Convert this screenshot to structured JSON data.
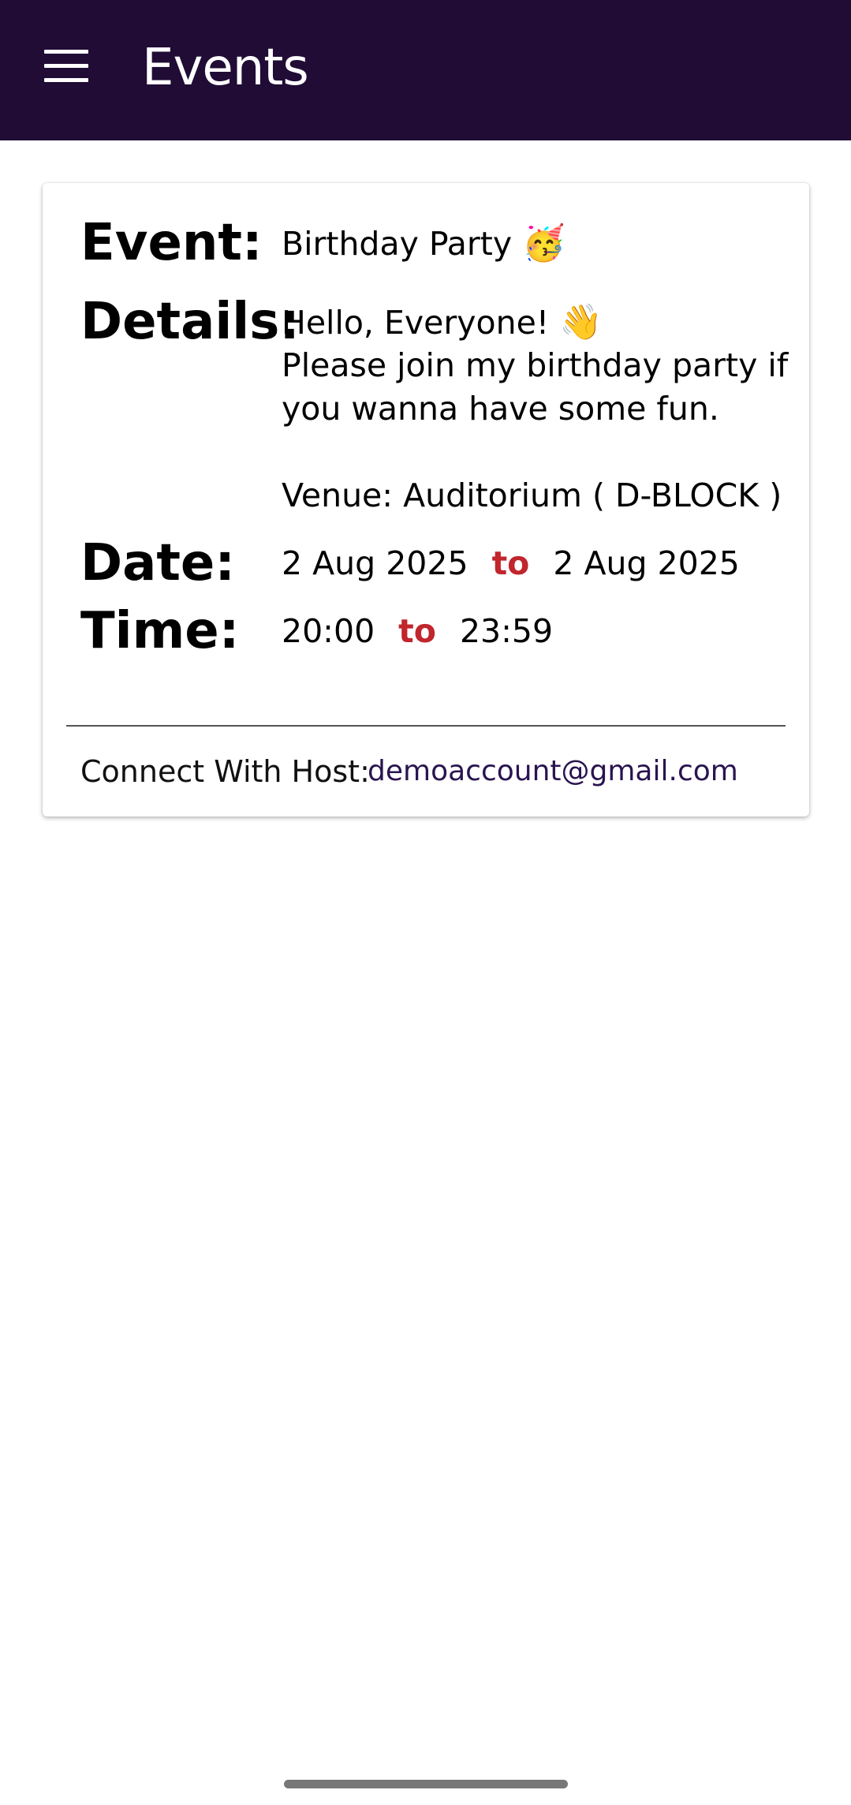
{
  "app_bar": {
    "title": "Events",
    "menu_icon": "hamburger-menu-icon"
  },
  "event_card": {
    "event_label": "Event:",
    "event_name": "Birthday Party",
    "event_emoji": "🥳",
    "details_label": "Details:",
    "details_greeting": "Hello, Everyone!",
    "details_greeting_emoji": "👋",
    "details_body": "Please join my birthday party if\nyou wanna have some fun.\n\nVenue: Auditorium ( D-BLOCK )",
    "date_label": "Date:",
    "date_start": "2 Aug 2025",
    "date_separator": "to",
    "date_end": "2 Aug 2025",
    "time_label": "Time:",
    "time_start": "20:00",
    "time_separator": "to",
    "time_end": "23:59",
    "host_label": "Connect With Host:",
    "host_email": "demoaccount@gmail.com"
  },
  "colors": {
    "app_bar_bg": "#200c35",
    "separator_red": "#c0262c",
    "email_text": "#2a1450"
  }
}
